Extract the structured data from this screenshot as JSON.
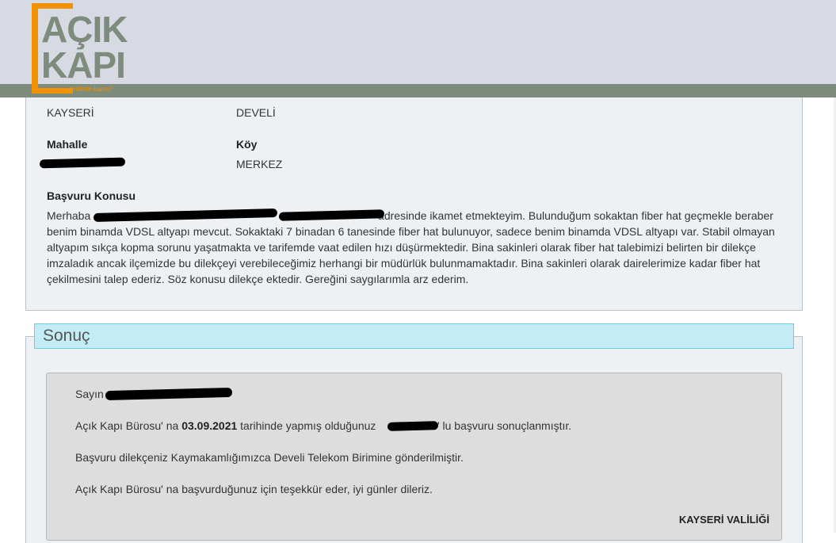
{
  "logo": {
    "line1": "AÇIK",
    "line2": "KAPI",
    "tagline": "\"milletin kapısı\""
  },
  "details": {
    "il_value": "KAYSERİ",
    "ilce_value": "DEVELİ",
    "mahalle_label": "Mahalle",
    "koy_label": "Köy",
    "koy_value": "MERKEZ",
    "konu_label": "Başvuru Konusu",
    "konu_text_start": "Merhaba",
    "konu_text_rest": "adresinde ikamet etmekteyim. Bulunduğum sokaktan fiber hat geçmekle beraber benim binamda VDSL altyapı mevcut. Sokaktaki 7 binadan 6 tanesinde fiber hat bulunuyor, sadece benim binamda VDSL altyapı var. Stabil olmayan altyapım sıkça kopma sorunu yaşatmakta ve tarifemde vaat edilen hızı düşürmektedir. Bina sakinleri olarak fiber hat talebimizi belirten bir dilekçe imzaladık ancak ilçemizde bu dilekçeyi verebileceğimiz herhangi bir müdürlük bulunmamaktadır. Bina sakinleri olarak dairelerimize kadar fiber hat çekilmesini talep ederiz. Söz konusu dilekçe ektedir. Gereğini saygılarımla arz ederim."
  },
  "sonuc": {
    "title": "Sonuç",
    "greeting": "Sayın",
    "line1_a": "Açık Kapı Bürosu' na ",
    "line1_date": "03.09.2021",
    "line1_b": " tarihinde yapmış olduğunuz",
    "line1_c": "no' lu başvuru sonuçlanmıştır.",
    "line2": "Başvuru dilekçeniz Kaymakamlığımızca Develi Telekom Birimine gönderilmiştir.",
    "line3": "Açık Kapı Bürosu' na başvurduğunuz için teşekkür eder, iyi günler dileriz.",
    "signature": "KAYSERİ VALİLİĞİ"
  },
  "colors": {
    "header_bg": "#d8dae3",
    "header_bar": "#7d8c7d",
    "logo_accent": "#f39200",
    "panel_bg": "#eef1f4",
    "tab_bg": "#c4ecf4",
    "result_bg": "#dddddd"
  }
}
